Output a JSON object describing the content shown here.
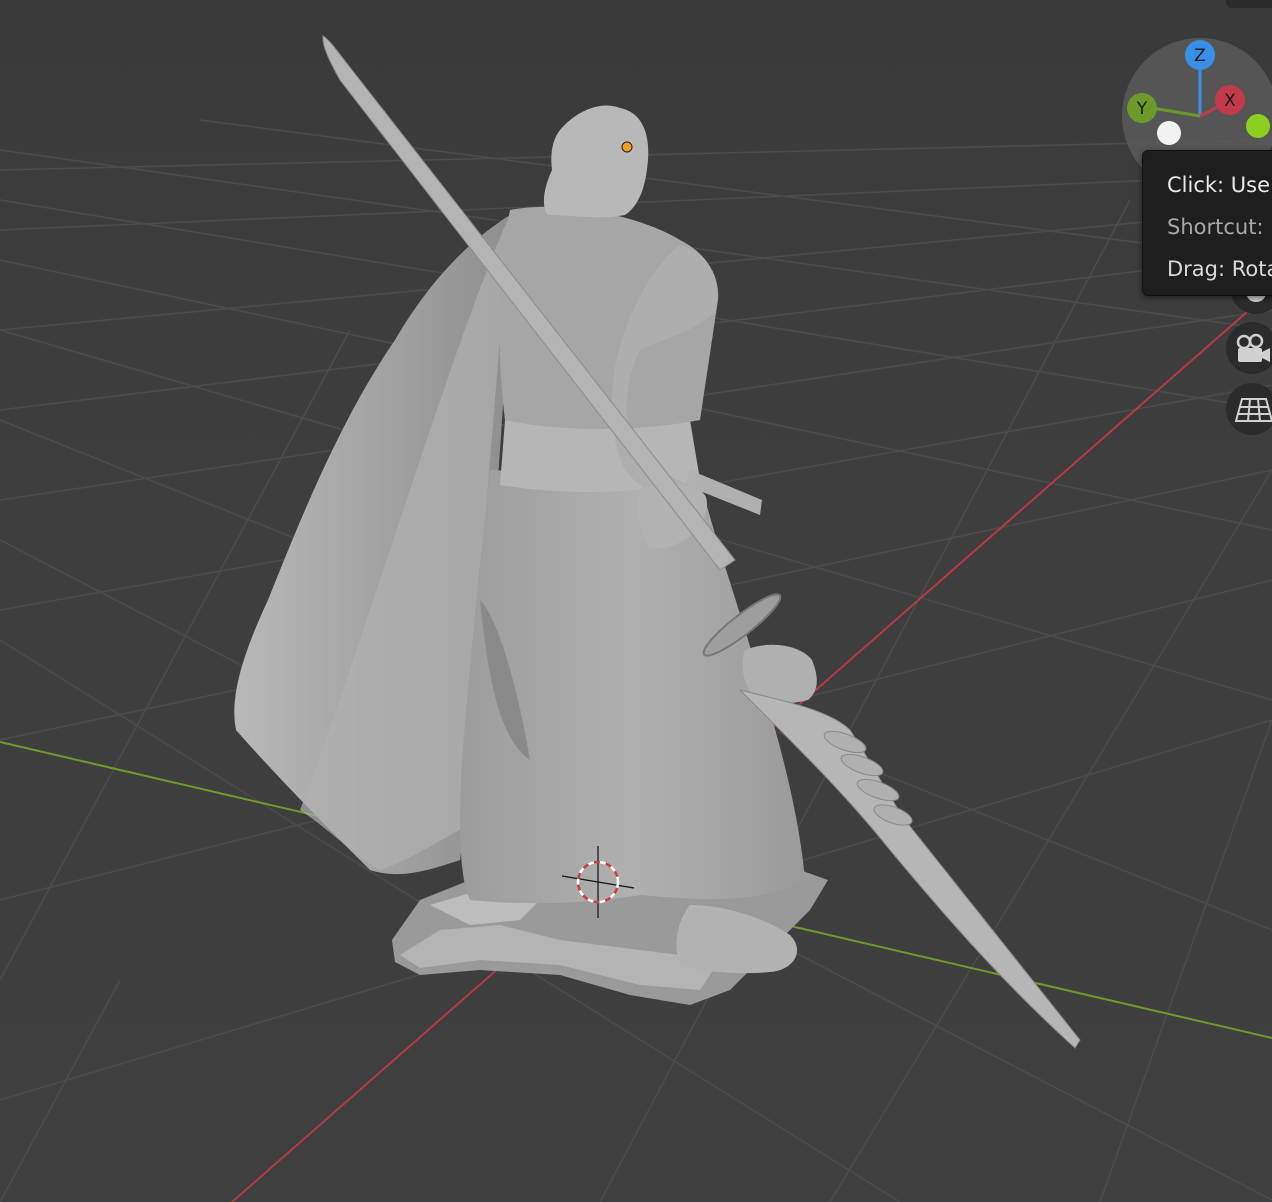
{
  "viewport": {
    "background": "#3d3d3d",
    "grid_color": "#4a4a4a",
    "x_axis_color": "#b53a45",
    "y_axis_color": "#6f9a2a",
    "model_color": "#a9a9a9"
  },
  "gizmo": {
    "z_label": "Z",
    "y_label": "Y",
    "x_label": "X",
    "z_color": "#3a8ee6",
    "y_color": "#6b9a2a",
    "x_color": "#c23b4a"
  },
  "tooltip": {
    "line1": "Click: Use",
    "line2": "Shortcut:",
    "line3": "Drag: Rota"
  },
  "nav_buttons": [
    {
      "icon": "hand-pan-icon"
    },
    {
      "icon": "camera-icon"
    },
    {
      "icon": "perspective-grid-icon"
    }
  ]
}
